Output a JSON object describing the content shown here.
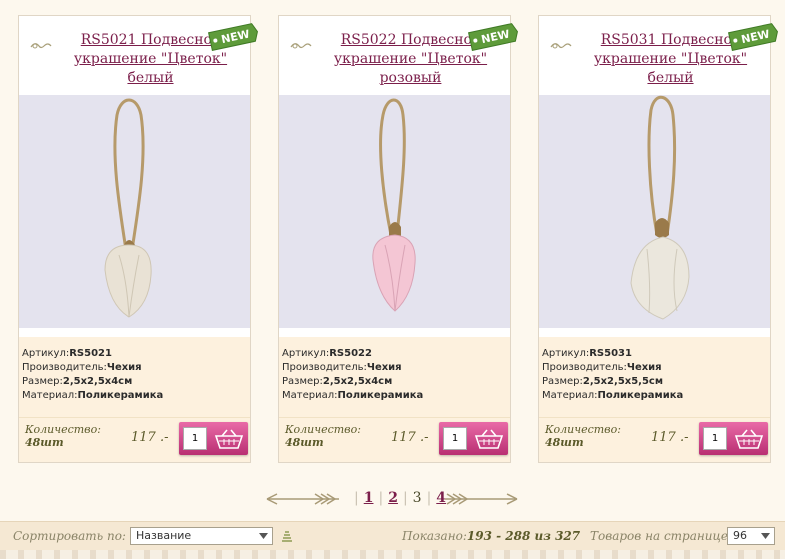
{
  "products": [
    {
      "title": "RS5021 Подвесное украшение \"Цветок\" белый",
      "badge": "NEW",
      "petal_color": "#e9e2d5",
      "article_label": "Артикул:",
      "article": "RS5021",
      "maker_label": "Производитель:",
      "maker": "Чехия",
      "size_label": "Размер:",
      "size": "2,5x2,5x4см",
      "material_label": "Материал:",
      "material": "Поликерамика",
      "qty_label": "Количество:",
      "qty": "48шт",
      "price": "117 .-",
      "cart_qty": "1"
    },
    {
      "title": "RS5022 Подвесное украшение \"Цветок\" розовый",
      "badge": "NEW",
      "petal_color": "#f4c6d4",
      "article_label": "Артикул:",
      "article": "RS5022",
      "maker_label": "Производитель:",
      "maker": "Чехия",
      "size_label": "Размер:",
      "size": "2,5x2,5x4см",
      "material_label": "Материал:",
      "material": "Поликерамика",
      "qty_label": "Количество:",
      "qty": "48шт",
      "price": "117 .-",
      "cart_qty": "1"
    },
    {
      "title": "RS5031 Подвесное украшение \"Цветок\" белый",
      "badge": "NEW",
      "petal_color": "#ebe7dd",
      "article_label": "Артикул:",
      "article": "RS5031",
      "maker_label": "Производитель:",
      "maker": "Чехия",
      "size_label": "Размер:",
      "size": "2,5x2,5x5,5см",
      "material_label": "Материал:",
      "material": "Поликерамика",
      "qty_label": "Количество:",
      "qty": "48шт",
      "price": "117 .-",
      "cart_qty": "1"
    }
  ],
  "pagination": {
    "pages": [
      "1",
      "2",
      "3",
      "4"
    ],
    "current": "3"
  },
  "toolbar": {
    "sort_label": "Сортировать по:",
    "sort_value": "Название",
    "shown_label": "Показано:",
    "shown_value": "193 - 288 из 327",
    "per_page_label": "Товаров на странице:",
    "per_page_value": "96"
  },
  "colors": {
    "accent": "#7b1e4a",
    "cart": "#d54b8c",
    "badge": "#5e9b3a",
    "panel": "#fdf1de"
  },
  "icons": [
    "swirl-icon",
    "new-badge",
    "basket-icon",
    "arrow-left-icon",
    "arrow-right-icon",
    "chevron-down-icon",
    "sort-direction-icon"
  ]
}
